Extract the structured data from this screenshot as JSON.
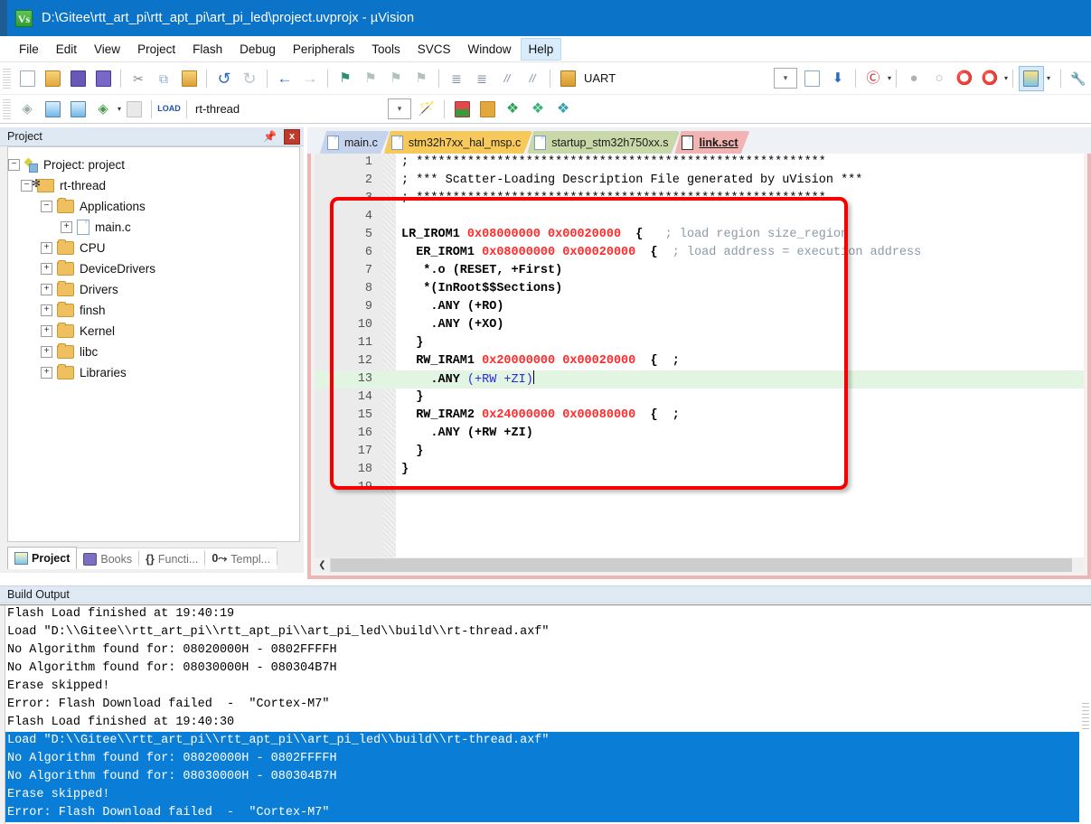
{
  "window": {
    "title": "D:\\Gitee\\rtt_art_pi\\rtt_apt_pi\\art_pi_led\\project.uvprojx - µVision",
    "app_icon": "uvision-icon",
    "icon_text": "Vs"
  },
  "menubar": {
    "items": [
      {
        "label": "File"
      },
      {
        "label": "Edit"
      },
      {
        "label": "View"
      },
      {
        "label": "Project"
      },
      {
        "label": "Flash"
      },
      {
        "label": "Debug"
      },
      {
        "label": "Peripherals"
      },
      {
        "label": "Tools"
      },
      {
        "label": "SVCS"
      },
      {
        "label": "Window"
      },
      {
        "label": "Help"
      }
    ],
    "hovered": "Help"
  },
  "toolbar_main": {
    "buttons": [
      {
        "name": "new-file-icon",
        "glyph": "⬜"
      },
      {
        "name": "open-file-icon",
        "glyph": "📂"
      },
      {
        "name": "save-icon",
        "glyph": "💾"
      },
      {
        "name": "save-all-icon",
        "glyph": "💾"
      },
      {
        "name": "cut-icon",
        "glyph": "✂"
      },
      {
        "name": "copy-icon",
        "glyph": "⧉"
      },
      {
        "name": "paste-icon",
        "glyph": "📋"
      },
      {
        "name": "undo-icon",
        "glyph": "↶"
      },
      {
        "name": "redo-icon",
        "glyph": "↷"
      },
      {
        "name": "navigate-back-icon",
        "glyph": "←"
      },
      {
        "name": "navigate-forward-icon",
        "glyph": "→"
      },
      {
        "name": "bookmark-toggle-icon",
        "glyph": "⚑"
      },
      {
        "name": "bookmark-prev-icon",
        "glyph": "⚑"
      },
      {
        "name": "bookmark-next-icon",
        "glyph": "⚑"
      },
      {
        "name": "bookmark-clear-icon",
        "glyph": "⚑"
      },
      {
        "name": "indent-increase-icon",
        "glyph": "≡"
      },
      {
        "name": "indent-decrease-icon",
        "glyph": "≡"
      },
      {
        "name": "comment-icon",
        "glyph": "//"
      },
      {
        "name": "uncomment-icon",
        "glyph": "//"
      },
      {
        "name": "find-in-files-icon",
        "glyph": "🔍"
      }
    ],
    "find_value": "UART",
    "right_buttons": [
      {
        "name": "select-target-dropdown",
        "glyph": "⌄"
      },
      {
        "name": "configure-icon",
        "glyph": "📄"
      },
      {
        "name": "debug-icon",
        "glyph": "⬇"
      },
      {
        "name": "search-tool-icon",
        "glyph": "ⓓ"
      },
      {
        "name": "breakpoint-disabled-icon",
        "glyph": "●"
      },
      {
        "name": "breakpoint-empty-icon",
        "glyph": "○"
      },
      {
        "name": "breakpoint-toggle-icon",
        "glyph": "⭕"
      },
      {
        "name": "breakpoint-kill-icon",
        "glyph": "⭕"
      },
      {
        "name": "manage-windows-icon",
        "glyph": "▤"
      },
      {
        "name": "extra-tool-icon",
        "glyph": "🔧"
      }
    ]
  },
  "toolbar_build": {
    "buttons": [
      {
        "name": "translate-icon",
        "glyph": "◈"
      },
      {
        "name": "build-icon",
        "glyph": "▦"
      },
      {
        "name": "rebuild-icon",
        "glyph": "▦"
      },
      {
        "name": "batch-build-icon",
        "glyph": "◈"
      },
      {
        "name": "stop-build-icon",
        "glyph": "▦"
      },
      {
        "name": "download-icon",
        "glyph": "LOAD"
      }
    ],
    "target_value": "rt-thread",
    "right_buttons": [
      {
        "name": "target-options-icon",
        "glyph": "🪄"
      },
      {
        "name": "manage-project-items-icon",
        "glyph": "▣"
      },
      {
        "name": "multi-project-icon",
        "glyph": "❐"
      },
      {
        "name": "pack-installer-icon",
        "glyph": "❖"
      },
      {
        "name": "manage-run-time-icon",
        "glyph": "❖"
      },
      {
        "name": "software-packs-icon",
        "glyph": "❖"
      }
    ]
  },
  "project_panel": {
    "title": "Project",
    "pin_icon": "pin-icon",
    "close_icon": "close-icon",
    "close_label": "x",
    "tree": [
      {
        "label": "Project: project",
        "level": 0,
        "expander": "−",
        "icon": "project-root-icon"
      },
      {
        "label": "rt-thread",
        "level": 1,
        "expander": "−",
        "icon": "target-icon"
      },
      {
        "label": "Applications",
        "level": 2,
        "expander": "−",
        "icon": "folder-icon"
      },
      {
        "label": "main.c",
        "level": 3,
        "expander": "+",
        "icon": "c-file-icon"
      },
      {
        "label": "CPU",
        "level": 2,
        "expander": "+",
        "icon": "folder-icon"
      },
      {
        "label": "DeviceDrivers",
        "level": 2,
        "expander": "+",
        "icon": "folder-icon"
      },
      {
        "label": "Drivers",
        "level": 2,
        "expander": "+",
        "icon": "folder-icon"
      },
      {
        "label": "finsh",
        "level": 2,
        "expander": "+",
        "icon": "folder-icon"
      },
      {
        "label": "Kernel",
        "level": 2,
        "expander": "+",
        "icon": "folder-icon"
      },
      {
        "label": "libc",
        "level": 2,
        "expander": "+",
        "icon": "folder-icon"
      },
      {
        "label": "Libraries",
        "level": 2,
        "expander": "+",
        "icon": "folder-icon"
      }
    ],
    "tabs": [
      {
        "label": "Project",
        "icon": "project-tab-icon",
        "selected": true
      },
      {
        "label": "Books",
        "icon": "books-tab-icon",
        "selected": false
      },
      {
        "label": "Functi...",
        "icon": "functions-tab-icon",
        "selected": false
      },
      {
        "label": "Templ...",
        "icon": "templates-tab-icon",
        "selected": false
      }
    ]
  },
  "editor": {
    "tabs": [
      {
        "label": "main.c",
        "color": "#c6d3ec",
        "selected": false
      },
      {
        "label": "stm32h7xx_hal_msp.c",
        "color": "#f7c95a",
        "selected": false
      },
      {
        "label": "startup_stm32h750xx.s",
        "color": "#c9d8a8",
        "selected": false
      },
      {
        "label": "link.sct",
        "color": "#f2b3b3",
        "selected": true
      }
    ],
    "active_file": "link.sct",
    "lines": [
      {
        "n": "1",
        "segments": [
          {
            "t": "; ********************************************************",
            "c": "cm"
          }
        ]
      },
      {
        "n": "2",
        "segments": [
          {
            "t": "; *** Scatter-Loading Description File generated by uVision ***",
            "c": "cm"
          }
        ]
      },
      {
        "n": "3",
        "segments": [
          {
            "t": "; ********************************************************",
            "c": "cm"
          }
        ]
      },
      {
        "n": "4",
        "segments": [
          {
            "t": "",
            "c": "pl"
          }
        ]
      },
      {
        "n": "5",
        "segments": [
          {
            "t": "LR_IROM1 ",
            "c": "kw"
          },
          {
            "t": "0x08000000 0x00020000",
            "c": "num"
          },
          {
            "t": "  {   ",
            "c": "kw"
          },
          {
            "t": "; load region size_region",
            "c": "cm"
          }
        ]
      },
      {
        "n": "6",
        "segments": [
          {
            "t": "  ER_IROM1 ",
            "c": "kw"
          },
          {
            "t": "0x08000000 0x00020000",
            "c": "num"
          },
          {
            "t": "  {  ",
            "c": "kw"
          },
          {
            "t": "; load address = execution address",
            "c": "cm"
          }
        ]
      },
      {
        "n": "7",
        "segments": [
          {
            "t": "   *.o (RESET, +First)",
            "c": "kw"
          }
        ]
      },
      {
        "n": "8",
        "segments": [
          {
            "t": "   *(InRoot$$Sections)",
            "c": "kw"
          }
        ]
      },
      {
        "n": "9",
        "segments": [
          {
            "t": "    .ANY (+RO)",
            "c": "kw"
          }
        ]
      },
      {
        "n": "10",
        "segments": [
          {
            "t": "    .ANY (+XO)",
            "c": "kw"
          }
        ]
      },
      {
        "n": "11",
        "segments": [
          {
            "t": "  }",
            "c": "kw"
          }
        ]
      },
      {
        "n": "12",
        "segments": [
          {
            "t": "  RW_IRAM1 ",
            "c": "kw"
          },
          {
            "t": "0x20000000 0x00020000",
            "c": "num"
          },
          {
            "t": "  {  ;",
            "c": "kw"
          }
        ]
      },
      {
        "n": "13",
        "segments": [
          {
            "t": "    .ANY ",
            "c": "kw"
          },
          {
            "t": "(+RW +ZI)",
            "c": "op"
          }
        ],
        "highlight": true,
        "caret": true
      },
      {
        "n": "14",
        "segments": [
          {
            "t": "  }",
            "c": "kw"
          }
        ]
      },
      {
        "n": "15",
        "segments": [
          {
            "t": "  RW_IRAM2 ",
            "c": "kw"
          },
          {
            "t": "0x24000000 0x00080000",
            "c": "num"
          },
          {
            "t": "  {  ;",
            "c": "kw"
          }
        ]
      },
      {
        "n": "16",
        "segments": [
          {
            "t": "    .ANY (+RW +ZI)",
            "c": "kw"
          }
        ]
      },
      {
        "n": "17",
        "segments": [
          {
            "t": "  }",
            "c": "kw"
          }
        ]
      },
      {
        "n": "18",
        "segments": [
          {
            "t": "}",
            "c": "kw"
          }
        ]
      },
      {
        "n": "19",
        "segments": [
          {
            "t": "",
            "c": "pl"
          }
        ]
      }
    ],
    "highlight_color": "#e2f5e2",
    "annotation_box_color": "#f40000",
    "hscroll_back_icon": "❮"
  },
  "build_output": {
    "title": "Build Output",
    "lines": [
      {
        "text": "Flash Load finished at 19:40:19",
        "selected": false
      },
      {
        "text": "Load \"D:\\\\Gitee\\\\rtt_art_pi\\\\rtt_apt_pi\\\\art_pi_led\\\\build\\\\rt-thread.axf\"",
        "selected": false
      },
      {
        "text": "No Algorithm found for: 08020000H - 0802FFFFH",
        "selected": false
      },
      {
        "text": "No Algorithm found for: 08030000H - 080304B7H",
        "selected": false
      },
      {
        "text": "Erase skipped!",
        "selected": false
      },
      {
        "text": "Error: Flash Download failed  -  \"Cortex-M7\"",
        "selected": false
      },
      {
        "text": "Flash Load finished at 19:40:30",
        "selected": false
      },
      {
        "text": "Load \"D:\\\\Gitee\\\\rtt_art_pi\\\\rtt_apt_pi\\\\art_pi_led\\\\build\\\\rt-thread.axf\"",
        "selected": true
      },
      {
        "text": "No Algorithm found for: 08020000H - 0802FFFFH",
        "selected": true
      },
      {
        "text": "No Algorithm found for: 08030000H - 080304B7H",
        "selected": true
      },
      {
        "text": "Erase skipped!",
        "selected": true
      },
      {
        "text": "Error: Flash Download failed  -  \"Cortex-M7\"",
        "selected": true
      }
    ],
    "selection_color": "#0a7ed6"
  }
}
